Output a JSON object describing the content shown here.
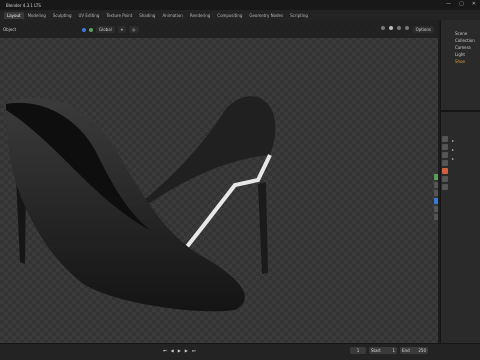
{
  "window": {
    "title": "Blender 4.3.1 LTS",
    "controls": [
      "—",
      "▢",
      "✕"
    ]
  },
  "menu": {
    "items": [
      "Layout",
      "Object"
    ]
  },
  "tabs": [
    "Layout",
    "Modeling",
    "Sculpting",
    "UV Editing",
    "Texture Paint",
    "Shading",
    "Animation",
    "Rendering",
    "Compositing",
    "Geometry Nodes",
    "Scripting"
  ],
  "viewport": {
    "mode": "Object",
    "transform": "Global",
    "options_label": "Options"
  },
  "outliner": {
    "rows": [
      "Scene",
      "Collection",
      "Camera",
      "Light",
      "Shoe"
    ]
  },
  "timeline": {
    "start": "1",
    "end": "250",
    "current": "1",
    "start_label": "Start",
    "end_label": "End"
  },
  "colors": {
    "accent": "#3a7bd5",
    "object_orange": "#e0a040",
    "green": "#5aa05a"
  }
}
